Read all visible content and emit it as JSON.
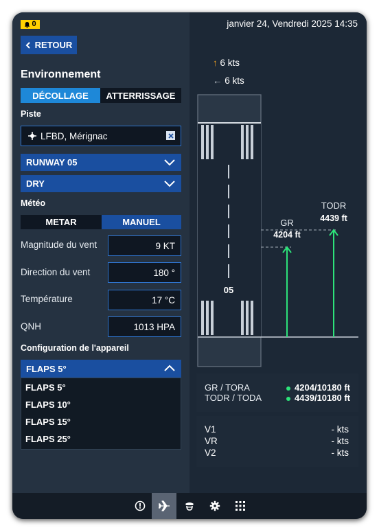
{
  "header": {
    "alert_count": "0",
    "datetime": "janvier 24, Vendredi 2025 14:35"
  },
  "back_label": "RETOUR",
  "environment": {
    "title": "Environnement",
    "tabs": [
      "DÉCOLLAGE",
      "ATTERRISSAGE"
    ],
    "active_tab": "DÉCOLLAGE"
  },
  "runway": {
    "section_label": "Piste",
    "airport": "LFBD, Mérignac",
    "runway": "RUNWAY 05",
    "surface": "DRY"
  },
  "weather": {
    "section_label": "Météo",
    "tabs": [
      "METAR",
      "MANUEL"
    ],
    "active_tab": "MANUEL",
    "fields": [
      {
        "label": "Magnitude du vent",
        "value": "9 KT"
      },
      {
        "label": "Direction du vent",
        "value": "180 °"
      },
      {
        "label": "Température",
        "value": "17 °C"
      },
      {
        "label": "QNH",
        "value": "1013 HPA"
      }
    ]
  },
  "aircraft": {
    "section_label": "Configuration de l'appareil",
    "flaps_selected": "FLAPS 5°",
    "flaps_options": [
      "FLAPS 5°",
      "FLAPS 10°",
      "FLAPS 15°",
      "FLAPS 25°"
    ]
  },
  "diagram": {
    "headwind": "6 kts",
    "crosswind": "6 kts",
    "runway_number": "05",
    "gr_label": "GR",
    "gr_value": "4204 ft",
    "todr_label": "TODR",
    "todr_value": "4439 ft",
    "colors": {
      "arrow": "#2de37a",
      "dash": "#8a94a0"
    }
  },
  "results": {
    "rows": [
      {
        "label": "GR / TORA",
        "value": "4204/10180 ft"
      },
      {
        "label": "TODR / TODA",
        "value": "4439/10180 ft"
      }
    ],
    "speeds": [
      {
        "label": "V1",
        "value": "- kts"
      },
      {
        "label": "VR",
        "value": "- kts"
      },
      {
        "label": "V2",
        "value": "- kts"
      }
    ]
  },
  "bottom_nav": {
    "items": [
      "info-icon",
      "airplane-icon",
      "pilot-icon",
      "gear-icon",
      "apps-icon"
    ],
    "active": "airplane-icon"
  }
}
